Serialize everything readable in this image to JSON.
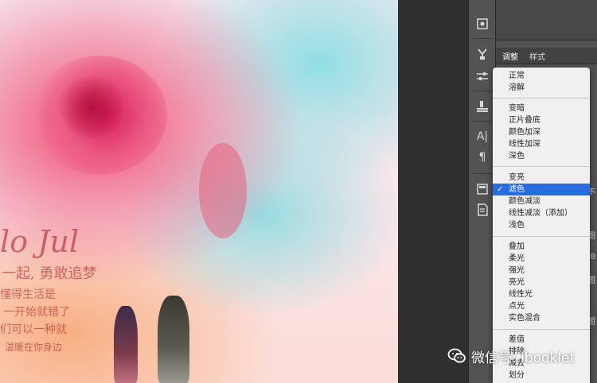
{
  "panel": {
    "tabs": [
      "调整",
      "样式"
    ],
    "edge_labels": [
      "不",
      "图",
      "8",
      "图",
      "图"
    ]
  },
  "blend_modes": {
    "groups": [
      [
        "正常",
        "溶解"
      ],
      [
        "变暗",
        "正片叠底",
        "颜色加深",
        "线性加深",
        "深色"
      ],
      [
        "变亮",
        "滤色",
        "颜色减淡",
        "线性减淡（添加）",
        "浅色"
      ],
      [
        "叠加",
        "柔光",
        "强光",
        "亮光",
        "线性光",
        "点光",
        "实色混合"
      ],
      [
        "差值",
        "排除",
        "减去",
        "划分"
      ]
    ],
    "selected": "滤色",
    "check_mark": "✓"
  },
  "tool_icons": [
    "history-icon",
    "brush-presets-icon",
    "adjust-sliders-icon",
    "clone-source-icon",
    "character-icon",
    "paragraph-icon",
    "notes-icon",
    "info-icon"
  ],
  "tool_glyphs": {
    "character": "A|",
    "paragraph": "¶"
  },
  "canvas": {
    "lines": [
      "lo Jul",
      "一起, 勇敢追梦",
      "懂得生活是",
      "一开始就错了",
      "们可以一种就",
      "温暖在你身边"
    ]
  },
  "watermark": {
    "text": "微信号: ibooklet",
    "color": "#ffffff"
  },
  "colors": {
    "menu_bg": "#f0f0f0",
    "selected_bg": "#2a6be0",
    "panel_bg": "#535353"
  }
}
